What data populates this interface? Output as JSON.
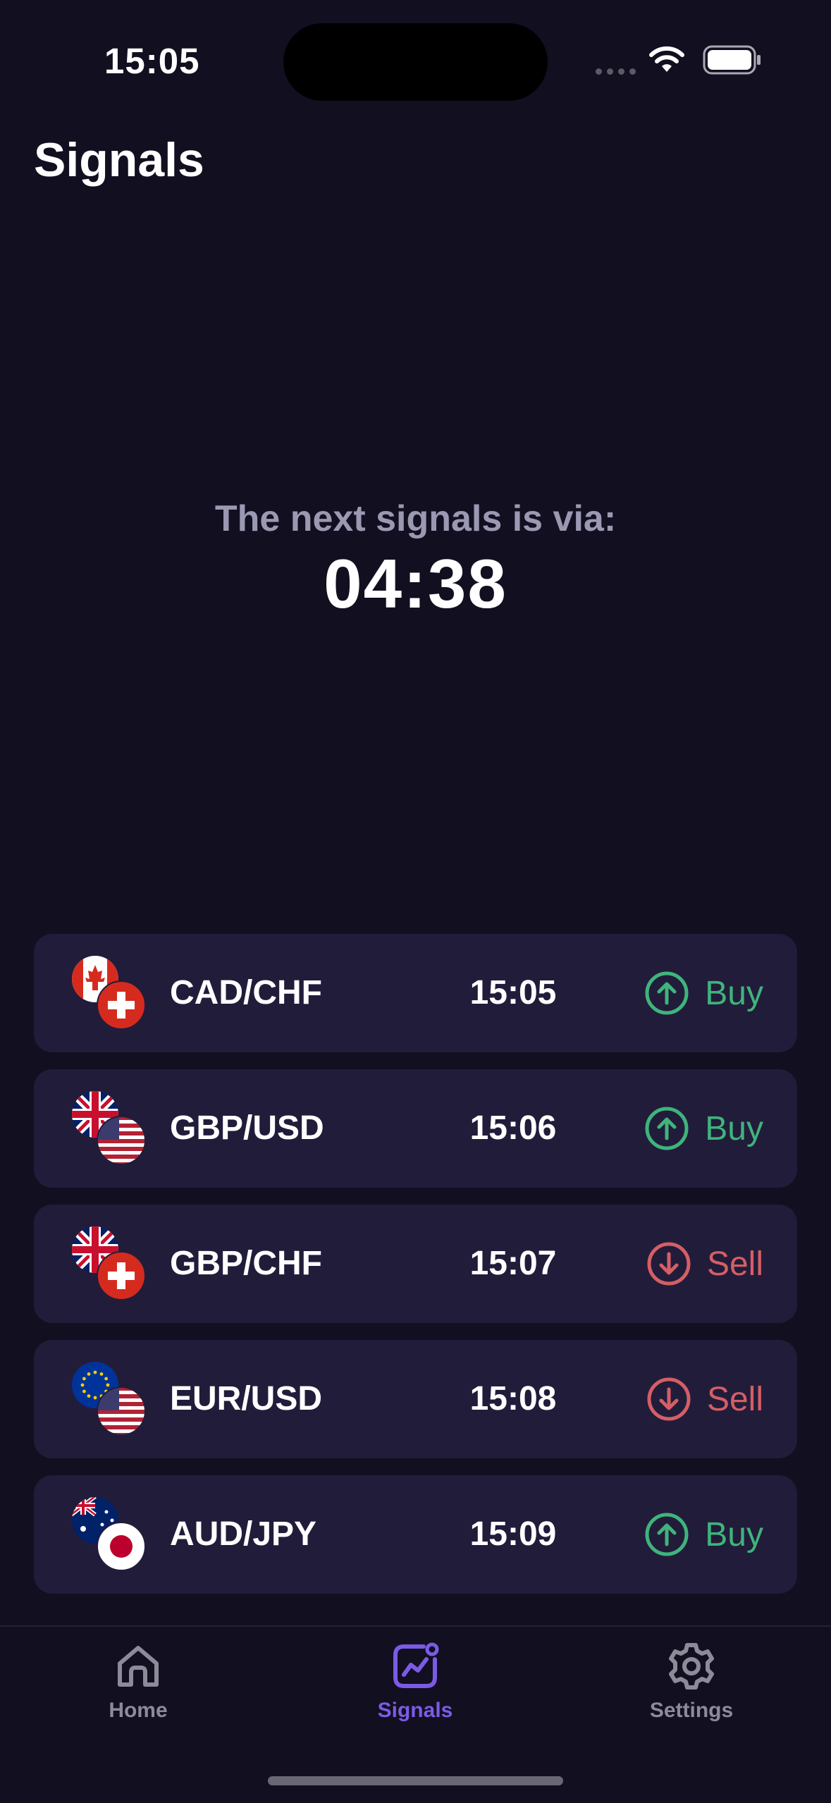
{
  "status_bar": {
    "time": "15:05"
  },
  "page_title": "Signals",
  "countdown": {
    "label": "The next signals is via:",
    "value": "04:38"
  },
  "signals": [
    {
      "pair": "CAD/CHF",
      "time": "15:05",
      "direction": "Buy",
      "flags": [
        "canada-flag-icon",
        "switzerland-flag-icon"
      ]
    },
    {
      "pair": "GBP/USD",
      "time": "15:06",
      "direction": "Buy",
      "flags": [
        "uk-flag-icon",
        "usa-flag-icon"
      ]
    },
    {
      "pair": "GBP/CHF",
      "time": "15:07",
      "direction": "Sell",
      "flags": [
        "uk-flag-icon",
        "switzerland-flag-icon"
      ]
    },
    {
      "pair": "EUR/USD",
      "time": "15:08",
      "direction": "Sell",
      "flags": [
        "eu-flag-icon",
        "usa-flag-icon"
      ]
    },
    {
      "pair": "AUD/JPY",
      "time": "15:09",
      "direction": "Buy",
      "flags": [
        "australia-flag-icon",
        "japan-flag-icon"
      ]
    }
  ],
  "tabs": [
    {
      "label": "Home",
      "icon": "home-icon",
      "active": false
    },
    {
      "label": "Signals",
      "icon": "chart-icon",
      "active": true
    },
    {
      "label": "Settings",
      "icon": "gear-icon",
      "active": false
    }
  ],
  "colors": {
    "background": "#120f20",
    "card": "#221c3b",
    "buy": "#3fb47b",
    "sell": "#d45f64",
    "accent": "#7b5be6"
  }
}
